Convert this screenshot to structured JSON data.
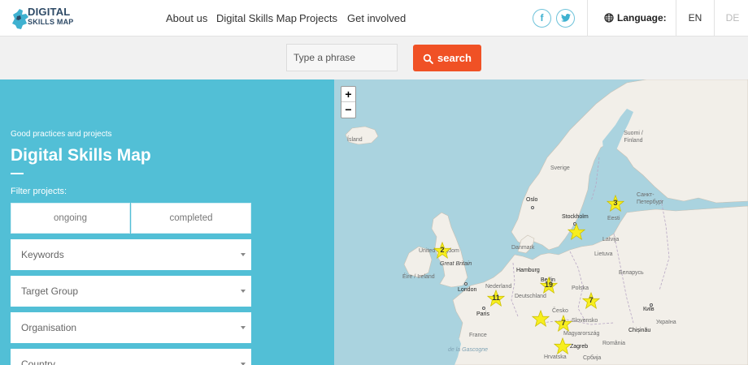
{
  "header": {
    "logo": {
      "line1": "DIGITAL",
      "line2": "SKILLS MAP"
    },
    "nav": [
      "About us",
      "Digital Skills Map",
      "Projects",
      "Get involved"
    ],
    "social": [
      {
        "icon": "facebook-icon",
        "glyph": "f"
      },
      {
        "icon": "twitter-icon",
        "glyph": "t"
      }
    ],
    "language_label": "Language:",
    "languages": [
      {
        "code": "EN",
        "active": true
      },
      {
        "code": "DE",
        "active": false
      }
    ]
  },
  "search": {
    "placeholder": "Type a phrase",
    "value": "",
    "button_label": "search"
  },
  "panel": {
    "breadcrumb": "Good practices and projects",
    "title": "Digital Skills Map",
    "filter_label": "Filter projects:",
    "toggles": [
      "ongoing",
      "completed"
    ],
    "selects": [
      "Keywords",
      "Target Group",
      "Organisation",
      "Country"
    ]
  },
  "map": {
    "zoom_in": "+",
    "zoom_out": "−",
    "labels": {
      "island": "Ísland",
      "suomi": "Suomi / Finland",
      "sverige": "Sverige",
      "oslo": "Oslo",
      "stockholm": "Stockholm",
      "eesti": "Eesti",
      "sankt": "Санкт-Петербург",
      "latvija": "Latvija",
      "danmark": "Danmark",
      "lietuva": "Lietuva",
      "uk": "United Kingdom",
      "gb": "Great Britain",
      "eire": "Éire / Ireland",
      "hamburg": "Hamburg",
      "berlin": "Berlin",
      "belarus": "Беларусь",
      "london": "London",
      "nederland": "Nederland",
      "polska": "Polska",
      "deutschland": "Deutschland",
      "paris": "Paris",
      "cesko": "Česko",
      "slovensko": "Slovensko",
      "kyiv": "Київ",
      "ukraina": "Україна",
      "chisinau": "Chișinău",
      "france": "France",
      "magyarorszag": "Magyarország",
      "romania": "România",
      "zagreb": "Zagreb",
      "hrvatska": "Hrvatska",
      "srbija": "Србија",
      "de_la_gascogne": "de la Gascogne"
    },
    "markers": [
      {
        "count": "3"
      },
      {
        "count": ""
      },
      {
        "count": "2"
      },
      {
        "count": "19"
      },
      {
        "count": "11"
      },
      {
        "count": "7"
      },
      {
        "count": ""
      },
      {
        "count": "7"
      },
      {
        "count": ""
      }
    ],
    "marker_color": "#f7ee1e"
  },
  "colors": {
    "accent": "#f05125",
    "panel": "#52bfd6",
    "sea": "#aad3df",
    "land": "#f2efe9"
  }
}
